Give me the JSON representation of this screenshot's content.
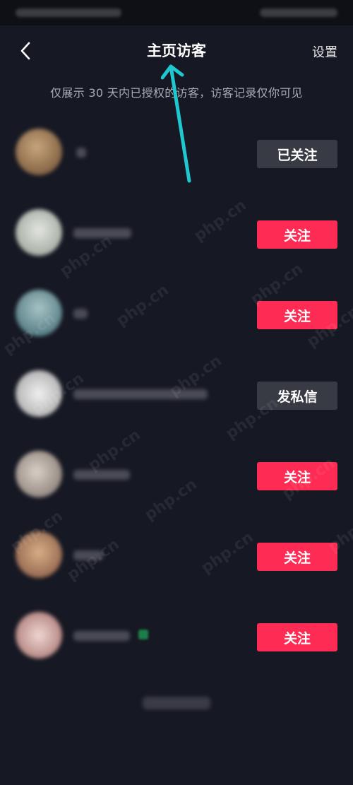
{
  "header": {
    "title": "主页访客",
    "settings_label": "设置"
  },
  "notice": "仅展示 30 天内已授权的访客，访客记录仅你可见",
  "visitors": [
    {
      "button_label": "已关注",
      "button_style": "followed",
      "avatar_color": "#8a6a48"
    },
    {
      "button_label": "关注",
      "button_style": "follow",
      "avatar_color": "#c7ccc7"
    },
    {
      "button_label": "关注",
      "button_style": "follow",
      "avatar_color": "#5d8a97"
    },
    {
      "button_label": "发私信",
      "button_style": "message",
      "avatar_color": "#d3d3d3"
    },
    {
      "button_label": "关注",
      "button_style": "follow",
      "avatar_color": "#b8ada5"
    },
    {
      "button_label": "关注",
      "button_style": "follow",
      "avatar_color": "#b38569"
    },
    {
      "button_label": "关注",
      "button_style": "follow",
      "avatar_color": "#c9a39f"
    }
  ],
  "watermark_text": "php.cn",
  "colors": {
    "background": "#161823",
    "follow_button": "#fe2c55",
    "followed_button": "#393b44",
    "annotation_arrow": "#1fc7cf"
  }
}
